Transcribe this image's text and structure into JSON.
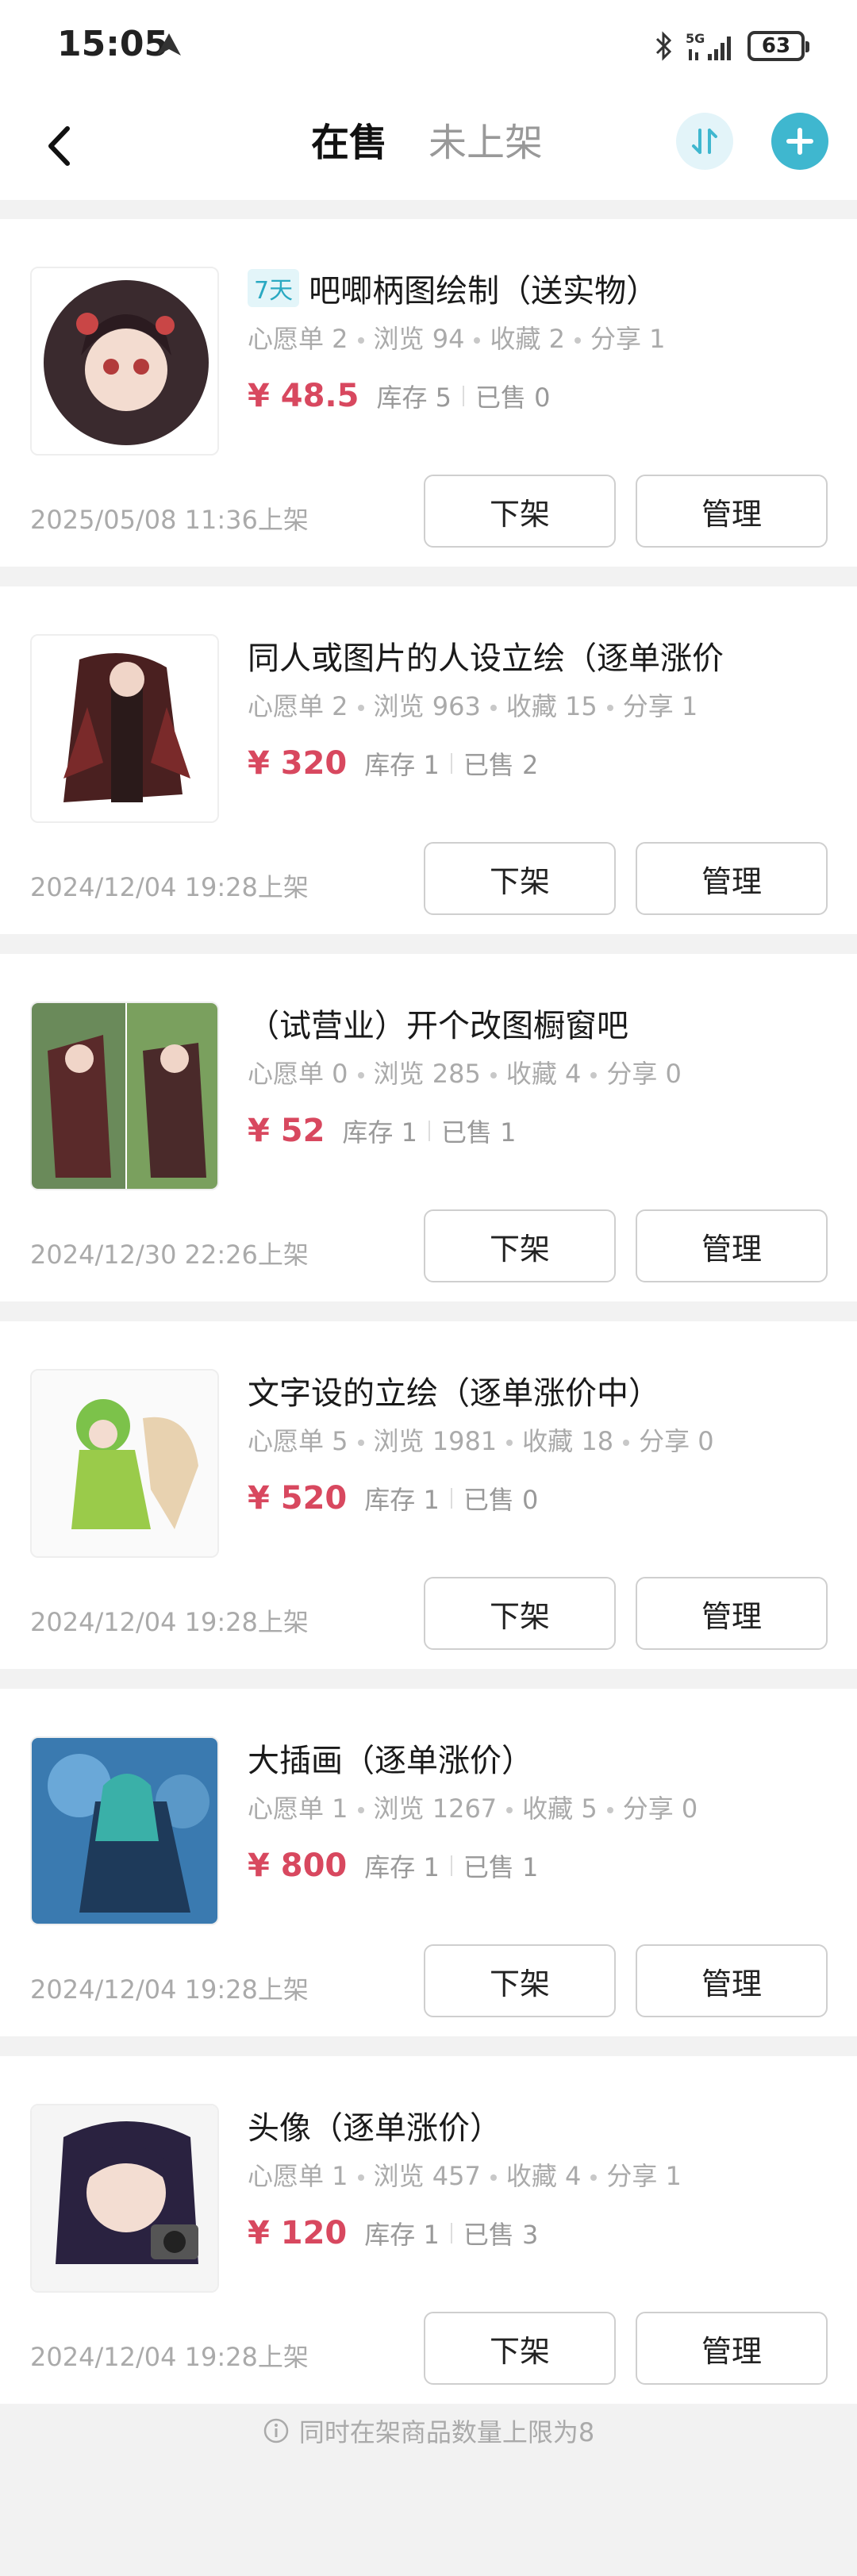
{
  "status_bar": {
    "time": "15:05",
    "battery": "63"
  },
  "header": {
    "tabs": [
      {
        "label": "在售",
        "active": true
      },
      {
        "label": "未上架",
        "active": false
      }
    ]
  },
  "colors": {
    "accent": "#3fb7cf",
    "price": "#d8485f"
  },
  "products": [
    {
      "tag": "7天",
      "title": "吧唧柄图绘制（送实物）",
      "wishlist": "心愿单 2",
      "views": "浏览 94",
      "favorites": "收藏 2",
      "shares": "分享 1",
      "price": "¥ 48.5",
      "stock": "库存 5",
      "sold": "已售 0",
      "date": "2025/05/08 11:36上架",
      "unlist_label": "下架",
      "manage_label": "管理"
    },
    {
      "tag": "",
      "title": "同人或图片的人设立绘（逐单涨价",
      "wishlist": "心愿单 2",
      "views": "浏览 963",
      "favorites": "收藏 15",
      "shares": "分享 1",
      "price": "¥ 320",
      "stock": "库存 1",
      "sold": "已售 2",
      "date": "2024/12/04 19:28上架",
      "unlist_label": "下架",
      "manage_label": "管理"
    },
    {
      "tag": "",
      "title": "（试营业）开个改图橱窗吧",
      "wishlist": "心愿单 0",
      "views": "浏览 285",
      "favorites": "收藏 4",
      "shares": "分享 0",
      "price": "¥ 52",
      "stock": "库存 1",
      "sold": "已售 1",
      "date": "2024/12/30 22:26上架",
      "unlist_label": "下架",
      "manage_label": "管理"
    },
    {
      "tag": "",
      "title": "文字设的立绘（逐单涨价中）",
      "wishlist": "心愿单 5",
      "views": "浏览 1981",
      "favorites": "收藏 18",
      "shares": "分享 0",
      "price": "¥ 520",
      "stock": "库存 1",
      "sold": "已售 0",
      "date": "2024/12/04 19:28上架",
      "unlist_label": "下架",
      "manage_label": "管理"
    },
    {
      "tag": "",
      "title": "大插画（逐单涨价）",
      "wishlist": "心愿单 1",
      "views": "浏览 1267",
      "favorites": "收藏 5",
      "shares": "分享 0",
      "price": "¥ 800",
      "stock": "库存 1",
      "sold": "已售 1",
      "date": "2024/12/04 19:28上架",
      "unlist_label": "下架",
      "manage_label": "管理"
    },
    {
      "tag": "",
      "title": "头像（逐单涨价）",
      "wishlist": "心愿单 1",
      "views": "浏览 457",
      "favorites": "收藏 4",
      "shares": "分享 1",
      "price": "¥ 120",
      "stock": "库存 1",
      "sold": "已售 3",
      "date": "2024/12/04 19:28上架",
      "unlist_label": "下架",
      "manage_label": "管理"
    }
  ],
  "footer": {
    "note": "同时在架商品数量上限为8"
  }
}
